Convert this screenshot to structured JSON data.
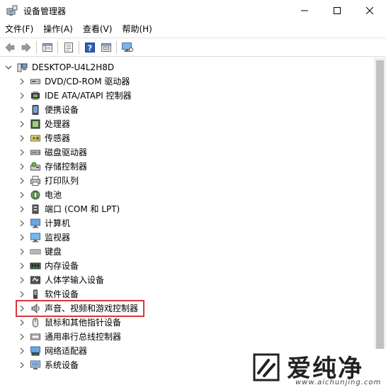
{
  "window": {
    "title": "设备管理器"
  },
  "menu": [
    "文件(F)",
    "操作(A)",
    "查看(V)",
    "帮助(H)"
  ],
  "toolbar": {
    "buttons": [
      "back-icon",
      "forward-icon",
      "properties-view-icon",
      "properties-icon",
      "help-icon",
      "update-driver-icon",
      "scan-hardware-icon"
    ]
  },
  "tree": {
    "root": "DESKTOP-U4L2H8D",
    "items": [
      {
        "label": "DVD/CD-ROM 驱动器",
        "icon": "dvd-drive-icon"
      },
      {
        "label": "IDE ATA/ATAPI 控制器",
        "icon": "ide-controller-icon"
      },
      {
        "label": "便携设备",
        "icon": "portable-device-icon"
      },
      {
        "label": "处理器",
        "icon": "processor-icon"
      },
      {
        "label": "传感器",
        "icon": "sensor-icon"
      },
      {
        "label": "磁盘驱动器",
        "icon": "disk-drive-icon"
      },
      {
        "label": "存储控制器",
        "icon": "storage-controller-icon"
      },
      {
        "label": "打印队列",
        "icon": "printer-icon"
      },
      {
        "label": "电池",
        "icon": "battery-icon"
      },
      {
        "label": "端口 (COM 和 LPT)",
        "icon": "port-icon"
      },
      {
        "label": "计算机",
        "icon": "computer-icon"
      },
      {
        "label": "监视器",
        "icon": "monitor-icon"
      },
      {
        "label": "键盘",
        "icon": "keyboard-icon"
      },
      {
        "label": "内存设备",
        "icon": "memory-icon"
      },
      {
        "label": "人体学输入设备",
        "icon": "hid-icon"
      },
      {
        "label": "软件设备",
        "icon": "software-device-icon"
      },
      {
        "label": "声音、视频和游戏控制器",
        "icon": "sound-icon",
        "highlighted": true
      },
      {
        "label": "鼠标和其他指针设备",
        "icon": "mouse-icon"
      },
      {
        "label": "通用串行总线控制器",
        "icon": "usb-icon"
      },
      {
        "label": "网络适配器",
        "icon": "network-adapter-icon"
      },
      {
        "label": "系统设备",
        "icon": "system-device-icon"
      }
    ]
  },
  "watermark": {
    "brand": "爱纯净",
    "url": "www.aichunjing.com"
  },
  "colors": {
    "highlight_border": "#d9383a",
    "scrollbar_track": "#f0f0f0",
    "scrollbar_thumb": "#c1c1c1"
  }
}
